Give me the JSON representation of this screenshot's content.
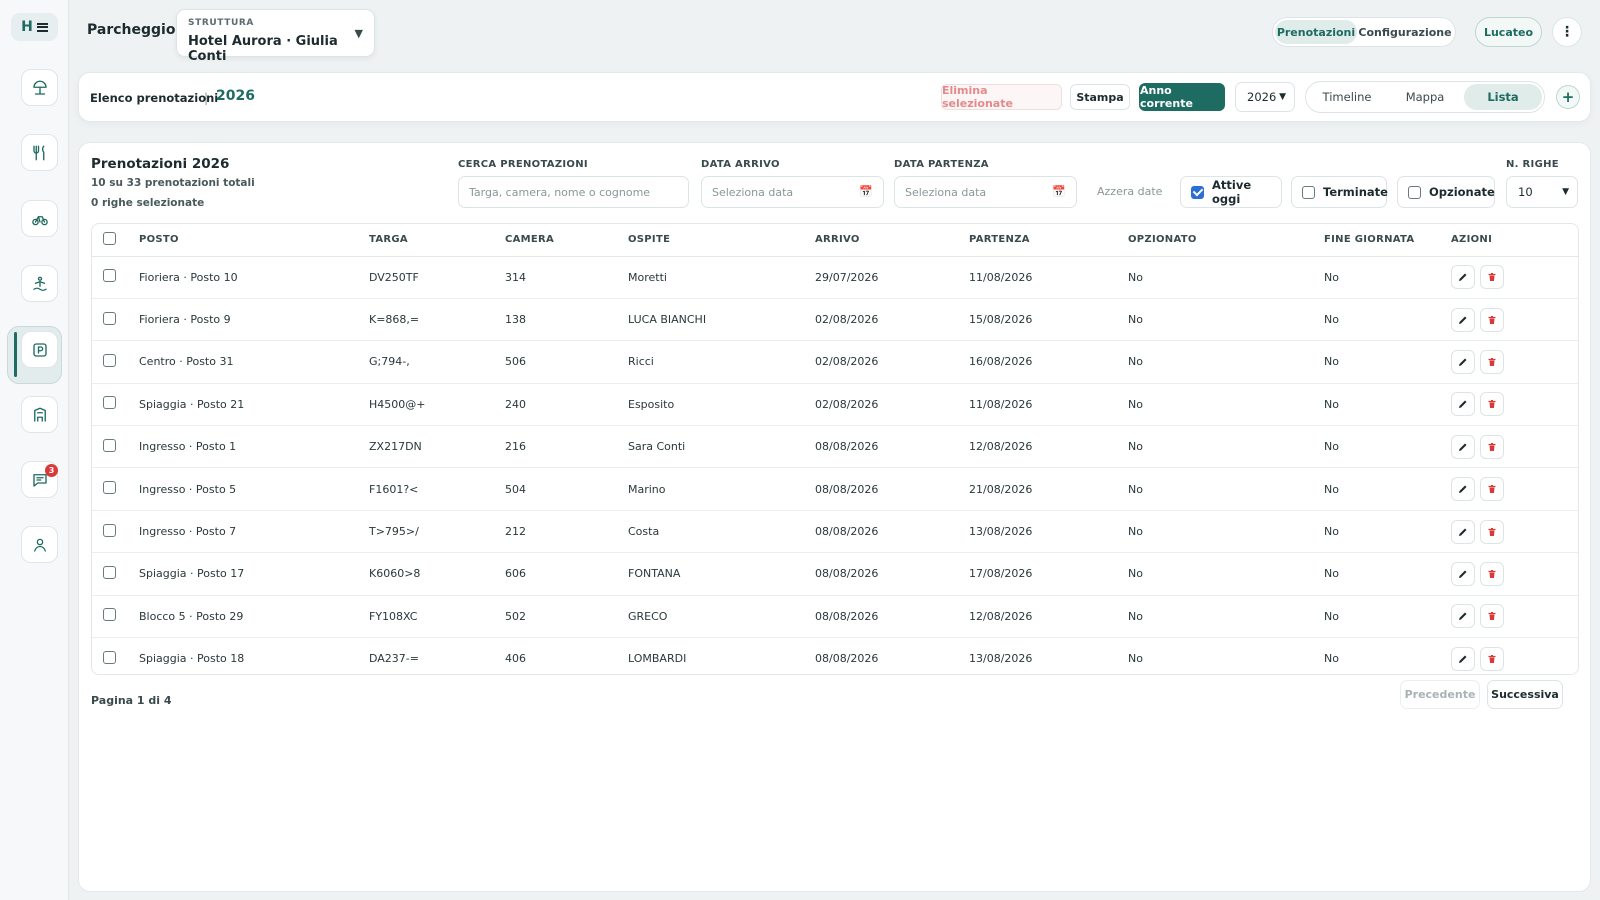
{
  "app": {
    "logo_letter": "H"
  },
  "sidebar": {
    "items": [
      {
        "name": "beach-umbrella-icon"
      },
      {
        "name": "restaurant-icon"
      },
      {
        "name": "bike-icon"
      },
      {
        "name": "wellness-icon"
      },
      {
        "name": "parking-icon",
        "active": true
      },
      {
        "name": "building-icon"
      },
      {
        "name": "chat-icon",
        "badge": "3"
      },
      {
        "name": "user-icon"
      }
    ]
  },
  "header": {
    "title": "Parcheggio",
    "structure_label": "STRUTTURA",
    "structure_value": "Hotel Aurora · Giulia Conti",
    "tabs": [
      {
        "label": "Prenotazioni",
        "active": true
      },
      {
        "label": "Configurazione",
        "active": false
      }
    ],
    "user_label": "Lucateo"
  },
  "toolbar": {
    "title": "Elenco prenotazioni",
    "separator": "|",
    "year": "2026",
    "delete_selected": "Elimina selezionate",
    "print": "Stampa",
    "current_year": "Anno corrente",
    "year_select_value": "2026",
    "views": [
      {
        "label": "Timeline",
        "active": false
      },
      {
        "label": "Mappa",
        "active": false
      },
      {
        "label": "Lista",
        "active": true
      }
    ],
    "add_label": "+"
  },
  "main": {
    "title": "Prenotazioni 2026",
    "count_text": "10 su 33 prenotazioni totali",
    "selected_text": "0 righe selezionate",
    "filters": {
      "search_label": "CERCA PRENOTAZIONI",
      "search_placeholder": "Targa, camera, nome o cognome",
      "arrival_label": "DATA ARRIVO",
      "arrival_placeholder": "Seleziona data",
      "departure_label": "DATA PARTENZA",
      "departure_placeholder": "Seleziona data",
      "reset_dates": "Azzera date",
      "active_today": {
        "label": "Attive oggi",
        "checked": true
      },
      "finished": {
        "label": "Terminate",
        "checked": false
      },
      "optioned": {
        "label": "Opzionate",
        "checked": false
      },
      "rows_label": "N. RIGHE",
      "rows_value": "10"
    },
    "columns": [
      "POSTO",
      "TARGA",
      "CAMERA",
      "OSPITE",
      "ARRIVO",
      "PARTENZA",
      "OPZIONATO",
      "FINE GIORNATA",
      "AZIONI"
    ],
    "rows": [
      {
        "posto": "Fioriera · Posto 10",
        "targa": "DV250TF",
        "camera": "314",
        "ospite": "Moretti",
        "arrivo": "29/07/2026",
        "partenza": "11/08/2026",
        "opzionato": "No",
        "fine": "No"
      },
      {
        "posto": "Fioriera · Posto 9",
        "targa": "K=868,=",
        "camera": "138",
        "ospite": "LUCA BIANCHI",
        "arrivo": "02/08/2026",
        "partenza": "15/08/2026",
        "opzionato": "No",
        "fine": "No"
      },
      {
        "posto": "Centro · Posto 31",
        "targa": "G;794-,",
        "camera": "506",
        "ospite": "Ricci",
        "arrivo": "02/08/2026",
        "partenza": "16/08/2026",
        "opzionato": "No",
        "fine": "No"
      },
      {
        "posto": "Spiaggia · Posto 21",
        "targa": "H4500@+",
        "camera": "240",
        "ospite": "Esposito",
        "arrivo": "02/08/2026",
        "partenza": "11/08/2026",
        "opzionato": "No",
        "fine": "No"
      },
      {
        "posto": "Ingresso · Posto 1",
        "targa": "ZX217DN",
        "camera": "216",
        "ospite": "Sara Conti",
        "arrivo": "08/08/2026",
        "partenza": "12/08/2026",
        "opzionato": "No",
        "fine": "No"
      },
      {
        "posto": "Ingresso · Posto 5",
        "targa": "F1601?<",
        "camera": "504",
        "ospite": "Marino",
        "arrivo": "08/08/2026",
        "partenza": "21/08/2026",
        "opzionato": "No",
        "fine": "No"
      },
      {
        "posto": "Ingresso · Posto 7",
        "targa": "T>795>/",
        "camera": "212",
        "ospite": "Costa",
        "arrivo": "08/08/2026",
        "partenza": "13/08/2026",
        "opzionato": "No",
        "fine": "No"
      },
      {
        "posto": "Spiaggia · Posto 17",
        "targa": "K6060>8",
        "camera": "606",
        "ospite": "FONTANA",
        "arrivo": "08/08/2026",
        "partenza": "17/08/2026",
        "opzionato": "No",
        "fine": "No"
      },
      {
        "posto": "Blocco 5 · Posto 29",
        "targa": "FY108XC",
        "camera": "502",
        "ospite": "GRECO",
        "arrivo": "08/08/2026",
        "partenza": "12/08/2026",
        "opzionato": "No",
        "fine": "No"
      },
      {
        "posto": "Spiaggia · Posto 18",
        "targa": "DA237-=",
        "camera": "406",
        "ospite": "LOMBARDI",
        "arrivo": "08/08/2026",
        "partenza": "13/08/2026",
        "opzionato": "No",
        "fine": "No"
      }
    ],
    "pager": {
      "text": "Pagina 1 di 4",
      "prev": "Precedente",
      "next": "Successiva"
    }
  },
  "colors": {
    "accent": "#1e6b61",
    "danger": "#d83a3a",
    "checkbox": "#2b6fd6"
  }
}
